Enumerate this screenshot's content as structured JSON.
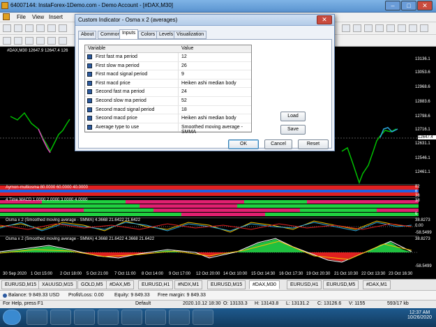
{
  "window": {
    "title": "64007144: InstaForex-1Demo.com - Demo Account - [#DAX,M30]",
    "min": "–",
    "max": "□",
    "close": "✕"
  },
  "menu": [
    "File",
    "View",
    "Insert"
  ],
  "chart": {
    "symbol_label": "#DAX,M30  12647.9 12647.4 126",
    "price_scale": [
      "13136.1",
      "13053.6",
      "12968.6",
      "12883.6",
      "12798.6",
      "12716.1",
      "12631.1",
      "12546.1",
      "12461.1"
    ],
    "current_price": "12647.4",
    "sub1_label": "Aymon-multiosma 80.0000 60.0000 40.0000",
    "sub1_scale": [
      "82",
      "6",
      "38"
    ],
    "sub2_label": "4 Time MACD 1.0000 2.0000 3.0000 4.0000",
    "sub2_scale": [
      "38",
      "6"
    ],
    "sub3_label": "Osma x 2 (Smoothed moving average - SMMA) 4.3668 21.6422 21.6422",
    "sub3_scale": [
      "38.8273",
      "0.00",
      "-58.5499"
    ],
    "sub4_label": "Osma x 2 (Smoothed moving average - SMMA) 4.3668 21.6422 4.3668 21.6422",
    "sub4_scale": [
      "38.8273",
      "-58.5499"
    ],
    "time_labels": [
      "30 Sep 2020",
      "1 Oct 15:00",
      "2 Oct 18:00",
      "5 Oct 21:00",
      "7 Oct 11:00",
      "8 Oct 14:00",
      "9 Oct 17:00",
      "12 Oct 20:00",
      "14 Oct 10:00",
      "15 Oct 14:30",
      "16 Oct 17:30",
      "19 Oct 20:30",
      "21 Oct 10:30",
      "22 Oct 13:30",
      "23 Oct 16:30"
    ]
  },
  "tabs": [
    "EURUSD,M15",
    "XAUUSD,M15",
    "GOLD,M5",
    "#DAX,M5",
    "EURUSD,H1",
    "#NDX,M1",
    "EURUSD,M15",
    "#DAX,M30",
    "EURUSD,H1",
    "EURUSD,M5",
    "#DAX,M1"
  ],
  "active_tab": "#DAX,M30",
  "terminal": {
    "balance": "Balance: 9 849.33 USD",
    "profit": "Profit/Loss: 0.00",
    "equity": "Equity: 9 849.33",
    "margin": "Free margin: 9 849.33"
  },
  "status": {
    "help": "For Help, press F1",
    "profile": "Default",
    "datetime": "2020.10.12 18:30",
    "open": "O: 13133.3",
    "high": "H: 13143.8",
    "low": "L: 13131.2",
    "close": "C: 13126.6",
    "volume": "V: 1155",
    "traffic": "593/17 kb"
  },
  "clock": {
    "time": "12:37 AM",
    "date": "10/26/2020"
  },
  "dialog": {
    "title": "Custom Indicator - Osma x 2 (averages)",
    "close": "✕",
    "tabs": [
      "About",
      "Common",
      "Inputs",
      "Colors",
      "Levels",
      "Visualization"
    ],
    "active_tab": "Inputs",
    "col_variable": "Variable",
    "col_value": "Value",
    "rows": [
      {
        "variable": "First fast ma period",
        "value": "12"
      },
      {
        "variable": "First slow ma period",
        "value": "26"
      },
      {
        "variable": "First macd signal period",
        "value": "9"
      },
      {
        "variable": "First macd price",
        "value": "Heiken ashi median body"
      },
      {
        "variable": "Second fast ma period",
        "value": "24"
      },
      {
        "variable": "Second slow ma period",
        "value": "52"
      },
      {
        "variable": "Second macd signal period",
        "value": "18"
      },
      {
        "variable": "Second macd price",
        "value": "Heiken ashi median body"
      },
      {
        "variable": "Average type to use",
        "value": "Smoothed moving average - SMMA"
      }
    ],
    "load": "Load",
    "save": "Save",
    "ok": "OK",
    "cancel": "Cancel",
    "reset": "Reset"
  }
}
